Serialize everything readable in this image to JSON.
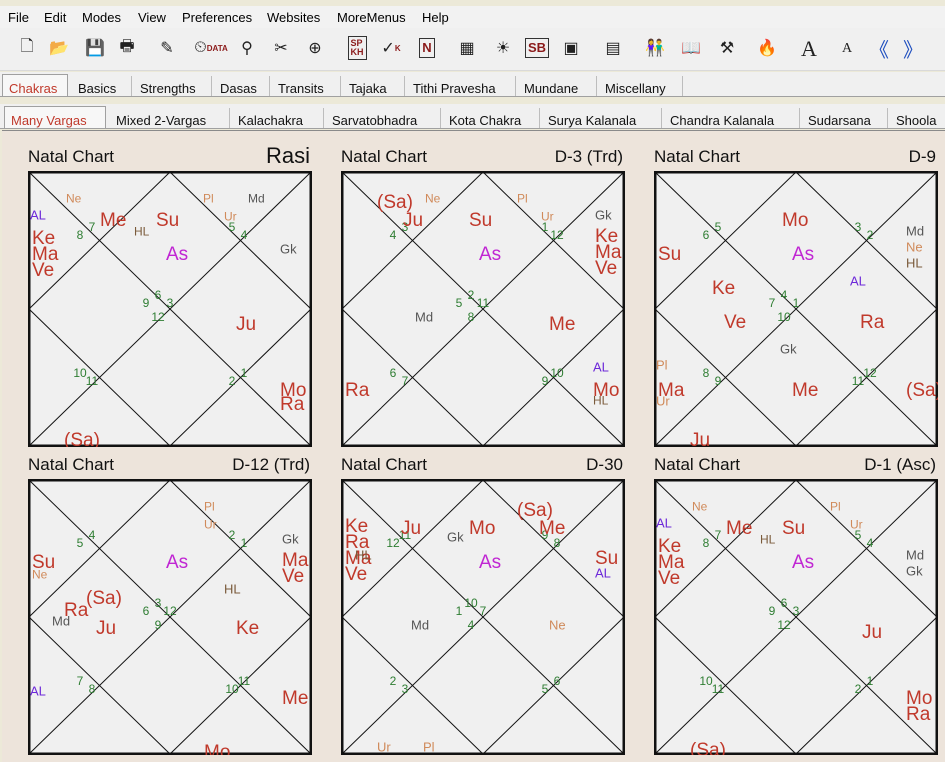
{
  "menu": [
    "File",
    "Edit",
    "Modes",
    "View",
    "Preferences",
    "Websites",
    "MoreMenus",
    "Help"
  ],
  "toolbar": [
    {
      "icon": "new-file-icon",
      "glyph": "🗋"
    },
    {
      "icon": "open-folder-icon",
      "glyph": "📂"
    },
    {
      "icon": "save-icon",
      "glyph": "💾"
    },
    {
      "icon": "print-icon",
      "glyph": "🖶"
    },
    {
      "icon": "chart-edit-icon",
      "glyph": "✎"
    },
    {
      "icon": "data-clock-icon",
      "glyph": "⏲",
      "label": "DATA"
    },
    {
      "icon": "match-icon",
      "glyph": "⚲"
    },
    {
      "icon": "remove-match-icon",
      "glyph": "✂"
    },
    {
      "icon": "transit-icon",
      "glyph": "⊕"
    },
    {
      "icon": "sp-kh-icon",
      "glyph": "",
      "label": "SP\nKH"
    },
    {
      "icon": "kp-icon",
      "glyph": "✓",
      "label": "K"
    },
    {
      "icon": "nakshatra-icon",
      "glyph": "",
      "label": "N"
    },
    {
      "icon": "grid-chart-icon",
      "glyph": "▦"
    },
    {
      "icon": "sun-icon",
      "glyph": "☀"
    },
    {
      "icon": "sb-icon",
      "glyph": "",
      "label": "SB"
    },
    {
      "icon": "square-chart-icon",
      "glyph": "▣"
    },
    {
      "icon": "table-icon",
      "glyph": "▤"
    },
    {
      "icon": "people-icon",
      "glyph": "👫"
    },
    {
      "icon": "book-icon",
      "glyph": "📖"
    },
    {
      "icon": "tools-icon",
      "glyph": "⚒"
    },
    {
      "icon": "fire-icon",
      "glyph": "🔥"
    },
    {
      "icon": "font-larger-icon",
      "glyph": "",
      "label": "A"
    },
    {
      "icon": "font-smaller-icon",
      "glyph": "",
      "label": "A"
    },
    {
      "icon": "back-icon",
      "glyph": "《"
    },
    {
      "icon": "forward-icon",
      "glyph": "》"
    }
  ],
  "tabs_top": [
    {
      "label": "Chakras",
      "selected": true
    },
    {
      "label": "Basics"
    },
    {
      "label": "Strengths"
    },
    {
      "label": "Dasas"
    },
    {
      "label": "Transits"
    },
    {
      "label": "Tajaka"
    },
    {
      "label": "Tithi Pravesha"
    },
    {
      "label": "Mundane"
    },
    {
      "label": "Miscellany"
    }
  ],
  "tabs_sub": [
    {
      "label": "Many Vargas",
      "selected": true
    },
    {
      "label": "Mixed 2-Vargas"
    },
    {
      "label": "Kalachakra"
    },
    {
      "label": "Sarvatobhadra"
    },
    {
      "label": "Kota Chakra"
    },
    {
      "label": "Surya Kalanala"
    },
    {
      "label": "Chandra Kalanala"
    },
    {
      "label": "Sudarsana"
    },
    {
      "label": "Shoola"
    }
  ],
  "colors": {
    "planet": "#c0392b",
    "asc": "#c026d3",
    "minor": "#d08a5a",
    "green": "#2e7d32",
    "purple": "#6d28d9",
    "grey": "#555555",
    "hl": "#7a5a3a"
  },
  "charts": [
    {
      "title": "Natal Chart",
      "varga": "Rasi",
      "houses": [
        [
          "8",
          "7"
        ],
        [
          "5",
          "4"
        ],
        [
          "9",
          "6",
          "3",
          "12"
        ],
        [
          "10",
          "11"
        ],
        [
          "2",
          "1"
        ]
      ],
      "planets": [
        {
          "t": "Ne",
          "c": "minor"
        },
        {
          "t": "Me",
          "c": "planet"
        },
        {
          "t": "Su",
          "c": "planet"
        },
        {
          "t": "Pl",
          "c": "minor"
        },
        {
          "t": "Md",
          "c": "grey"
        },
        {
          "t": "AL",
          "c": "purple"
        },
        {
          "t": "Ke",
          "c": "planet"
        },
        {
          "t": "Ma",
          "c": "planet"
        },
        {
          "t": "Ve",
          "c": "planet"
        },
        {
          "t": "HL",
          "c": "hl"
        },
        {
          "t": "Ur",
          "c": "minor"
        },
        {
          "t": "As",
          "c": "asc"
        },
        {
          "t": "Gk",
          "c": "grey"
        },
        {
          "t": "Ju",
          "c": "planet"
        },
        {
          "t": "Mo",
          "c": "planet"
        },
        {
          "t": "Ra",
          "c": "planet"
        },
        {
          "t": "(Sa)",
          "c": "planet"
        }
      ]
    },
    {
      "title": "Natal Chart",
      "varga": "D-3 (Trd)",
      "houses": [
        [
          "4",
          "3"
        ],
        [
          "1",
          "12"
        ],
        [
          "5",
          "2",
          "11",
          "8"
        ],
        [
          "6",
          "7"
        ],
        [
          "9",
          "10"
        ]
      ],
      "planets": [
        {
          "t": "(Sa)",
          "c": "planet"
        },
        {
          "t": "Ne",
          "c": "minor"
        },
        {
          "t": "Ju",
          "c": "planet"
        },
        {
          "t": "Su",
          "c": "planet"
        },
        {
          "t": "Pl",
          "c": "minor"
        },
        {
          "t": "Ur",
          "c": "minor"
        },
        {
          "t": "Gk",
          "c": "grey"
        },
        {
          "t": "Ke",
          "c": "planet"
        },
        {
          "t": "Ma",
          "c": "planet"
        },
        {
          "t": "Ve",
          "c": "planet"
        },
        {
          "t": "As",
          "c": "asc"
        },
        {
          "t": "Md",
          "c": "grey"
        },
        {
          "t": "Me",
          "c": "planet"
        },
        {
          "t": "AL",
          "c": "purple"
        },
        {
          "t": "Mo",
          "c": "planet"
        },
        {
          "t": "HL",
          "c": "hl"
        },
        {
          "t": "Ra",
          "c": "planet"
        }
      ]
    },
    {
      "title": "Natal Chart",
      "varga": "D-9",
      "houses": [
        [
          "6",
          "5"
        ],
        [
          "3",
          "2"
        ],
        [
          "7",
          "4",
          "1",
          "10"
        ],
        [
          "8",
          "9"
        ],
        [
          "11",
          "12"
        ]
      ],
      "planets": [
        {
          "t": "Mo",
          "c": "planet"
        },
        {
          "t": "Su",
          "c": "planet"
        },
        {
          "t": "As",
          "c": "asc"
        },
        {
          "t": "Md",
          "c": "grey"
        },
        {
          "t": "Ne",
          "c": "minor"
        },
        {
          "t": "HL",
          "c": "hl"
        },
        {
          "t": "AL",
          "c": "purple"
        },
        {
          "t": "Ke",
          "c": "planet"
        },
        {
          "t": "Ve",
          "c": "planet"
        },
        {
          "t": "Gk",
          "c": "grey"
        },
        {
          "t": "Ra",
          "c": "planet"
        },
        {
          "t": "Pl",
          "c": "minor"
        },
        {
          "t": "Ma",
          "c": "planet"
        },
        {
          "t": "Ur",
          "c": "minor"
        },
        {
          "t": "Me",
          "c": "planet"
        },
        {
          "t": "(Sa)",
          "c": "planet"
        },
        {
          "t": "Ju",
          "c": "planet"
        }
      ]
    },
    {
      "title": "Natal Chart",
      "varga": "D-12 (Trd)",
      "houses": [
        [
          "5",
          "4"
        ],
        [
          "2",
          "1"
        ],
        [
          "6",
          "3",
          "12",
          "9"
        ],
        [
          "7",
          "8"
        ],
        [
          "10",
          "11"
        ]
      ],
      "planets": [
        {
          "t": "Pl",
          "c": "minor"
        },
        {
          "t": "Ur",
          "c": "minor"
        },
        {
          "t": "Gk",
          "c": "grey"
        },
        {
          "t": "Su",
          "c": "planet"
        },
        {
          "t": "Ne",
          "c": "minor"
        },
        {
          "t": "As",
          "c": "asc"
        },
        {
          "t": "Ma",
          "c": "planet"
        },
        {
          "t": "Ve",
          "c": "planet"
        },
        {
          "t": "(Sa)",
          "c": "planet"
        },
        {
          "t": "HL",
          "c": "hl"
        },
        {
          "t": "Ra",
          "c": "planet"
        },
        {
          "t": "Md",
          "c": "grey"
        },
        {
          "t": "Ju",
          "c": "planet"
        },
        {
          "t": "Ke",
          "c": "planet"
        },
        {
          "t": "AL",
          "c": "purple"
        },
        {
          "t": "Me",
          "c": "planet"
        },
        {
          "t": "Mo",
          "c": "planet"
        }
      ]
    },
    {
      "title": "Natal Chart",
      "varga": "D-30",
      "houses": [
        [
          "12",
          "11"
        ],
        [
          "9",
          "8"
        ],
        [
          "1",
          "10",
          "7",
          "4"
        ],
        [
          "2",
          "3"
        ],
        [
          "5",
          "6"
        ]
      ],
      "planets": [
        {
          "t": "Ke",
          "c": "planet"
        },
        {
          "t": "Ra",
          "c": "planet"
        },
        {
          "t": "Ma",
          "c": "planet"
        },
        {
          "t": "HL",
          "c": "hl"
        },
        {
          "t": "Ve",
          "c": "planet"
        },
        {
          "t": "Ju",
          "c": "planet"
        },
        {
          "t": "Gk",
          "c": "grey"
        },
        {
          "t": "Mo",
          "c": "planet"
        },
        {
          "t": "(Sa)",
          "c": "planet"
        },
        {
          "t": "Me",
          "c": "planet"
        },
        {
          "t": "As",
          "c": "asc"
        },
        {
          "t": "Su",
          "c": "planet"
        },
        {
          "t": "AL",
          "c": "purple"
        },
        {
          "t": "Md",
          "c": "grey"
        },
        {
          "t": "Ne",
          "c": "minor"
        },
        {
          "t": "Ur",
          "c": "minor"
        },
        {
          "t": "Pl",
          "c": "minor"
        }
      ]
    },
    {
      "title": "Natal Chart",
      "varga": "D-1 (Asc)",
      "houses": [
        [
          "8",
          "7"
        ],
        [
          "5",
          "4"
        ],
        [
          "9",
          "6",
          "3",
          "12"
        ],
        [
          "10",
          "11"
        ],
        [
          "2",
          "1"
        ]
      ],
      "planets": [
        {
          "t": "Ne",
          "c": "minor"
        },
        {
          "t": "Me",
          "c": "planet"
        },
        {
          "t": "Su",
          "c": "planet"
        },
        {
          "t": "Pl",
          "c": "minor"
        },
        {
          "t": "Ur",
          "c": "minor"
        },
        {
          "t": "AL",
          "c": "purple"
        },
        {
          "t": "Ke",
          "c": "planet"
        },
        {
          "t": "Ma",
          "c": "planet"
        },
        {
          "t": "Ve",
          "c": "planet"
        },
        {
          "t": "HL",
          "c": "hl"
        },
        {
          "t": "As",
          "c": "asc"
        },
        {
          "t": "Md",
          "c": "grey"
        },
        {
          "t": "Gk",
          "c": "grey"
        },
        {
          "t": "Ju",
          "c": "planet"
        },
        {
          "t": "Mo",
          "c": "planet"
        },
        {
          "t": "Ra",
          "c": "planet"
        },
        {
          "t": "(Sa)",
          "c": "planet"
        }
      ]
    }
  ]
}
